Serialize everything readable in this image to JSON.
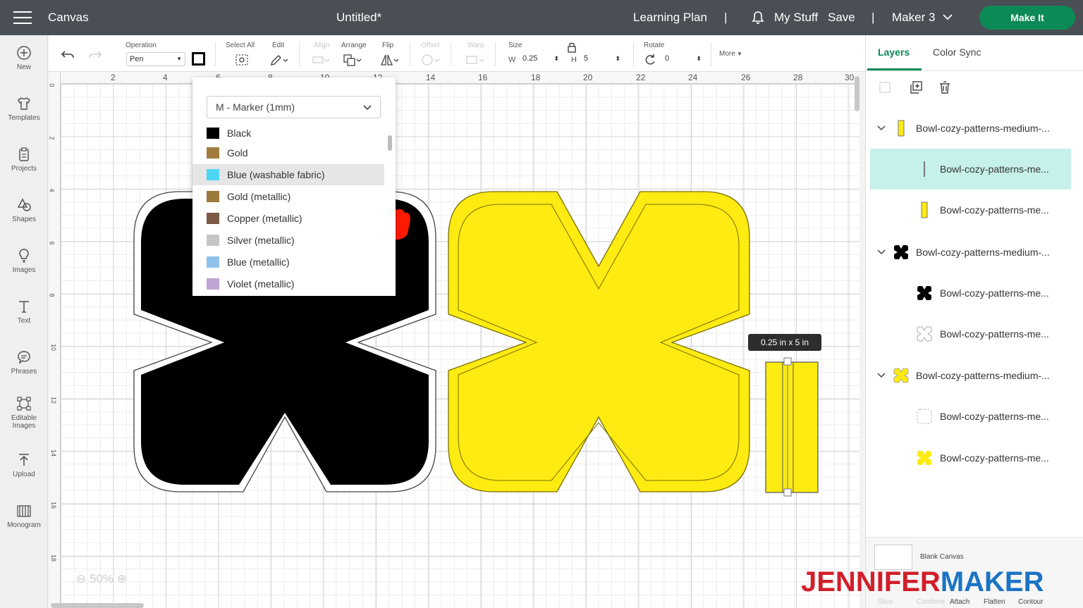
{
  "topbar": {
    "title": "Canvas",
    "document": "Untitled*",
    "learning_plan": "Learning Plan",
    "separator": "|",
    "my_stuff": "My Stuff",
    "save": "Save",
    "machine": "Maker 3",
    "make_it": "Make It"
  },
  "leftbar": {
    "items": [
      {
        "label": "New",
        "icon": "plus-circle-icon"
      },
      {
        "label": "Templates",
        "icon": "shirt-icon"
      },
      {
        "label": "Projects",
        "icon": "clipboard-icon"
      },
      {
        "label": "Shapes",
        "icon": "shapes-icon"
      },
      {
        "label": "Images",
        "icon": "lightbulb-icon"
      },
      {
        "label": "Text",
        "icon": "text-icon"
      },
      {
        "label": "Phrases",
        "icon": "speech-bubble-icon"
      },
      {
        "label": "Editable",
        "label2": "Images",
        "icon": "edit-image-icon"
      },
      {
        "label": "Upload",
        "icon": "upload-icon"
      },
      {
        "label": "Monogram",
        "icon": "monogram-icon"
      }
    ]
  },
  "toolbar": {
    "operation_label": "Operation",
    "operation_value": "Pen",
    "select_all": "Select All",
    "edit": "Edit",
    "align": "Align",
    "arrange": "Arrange",
    "flip": "Flip",
    "offset": "Offset",
    "warp": "Warp",
    "size": "Size",
    "w_label": "W",
    "w_value": "0.25",
    "h_label": "H",
    "h_value": "5",
    "rotate": "Rotate",
    "rotate_value": "0",
    "more": "More"
  },
  "ruler": {
    "top": [
      "2",
      "4",
      "6",
      "8",
      "10",
      "12",
      "14",
      "16",
      "18",
      "20",
      "22",
      "24",
      "26",
      "28",
      "30"
    ],
    "left": [
      "0",
      "2",
      "4",
      "6",
      "8",
      "10",
      "12",
      "14",
      "16",
      "18"
    ]
  },
  "zoom": "50%",
  "dropdown": {
    "selected": "M - Marker (1mm)",
    "items": [
      {
        "label": "Black",
        "color": "#000000"
      },
      {
        "label": "Gold",
        "color": "#a07c3e"
      },
      {
        "label": "Blue (washable fabric)",
        "color": "#4fd6f5"
      },
      {
        "label": "Gold (metallic)",
        "color": "#9b7a3c"
      },
      {
        "label": "Copper (metallic)",
        "color": "#7a5a45"
      },
      {
        "label": "Silver (metallic)",
        "color": "#c6c6c6"
      },
      {
        "label": "Blue (metallic)",
        "color": "#8fc2ea"
      },
      {
        "label": "Violet (metallic)",
        "color": "#c0a4d4"
      }
    ]
  },
  "tooltip": "0.25  in x 5  in",
  "colors": {
    "black_shape": "#000000",
    "yellow_shape": "#fdeb12",
    "teal_select": "#c6f1ea",
    "make_it": "#0c8a55"
  },
  "panel": {
    "tabs": [
      "Layers",
      "Color Sync"
    ],
    "layers": [
      {
        "name": "Bowl-cozy-patterns-medium-..."
      },
      {
        "name": "Bowl-cozy-patterns-me..."
      },
      {
        "name": "Bowl-cozy-patterns-me..."
      },
      {
        "name": "Bowl-cozy-patterns-medium-..."
      },
      {
        "name": "Bowl-cozy-patterns-me..."
      },
      {
        "name": "Bowl-cozy-patterns-me..."
      },
      {
        "name": "Bowl-cozy-patterns-medium-..."
      },
      {
        "name": "Bowl-cozy-patterns-me..."
      },
      {
        "name": "Bowl-cozy-patterns-me..."
      }
    ],
    "blank_canvas": "Blank Canvas",
    "bottom_actions": [
      "Slice",
      "Combine",
      "Attach",
      "Flatten",
      "Contour"
    ]
  },
  "brand": {
    "part1": "JENNIFER",
    "part2": "MAKER"
  }
}
